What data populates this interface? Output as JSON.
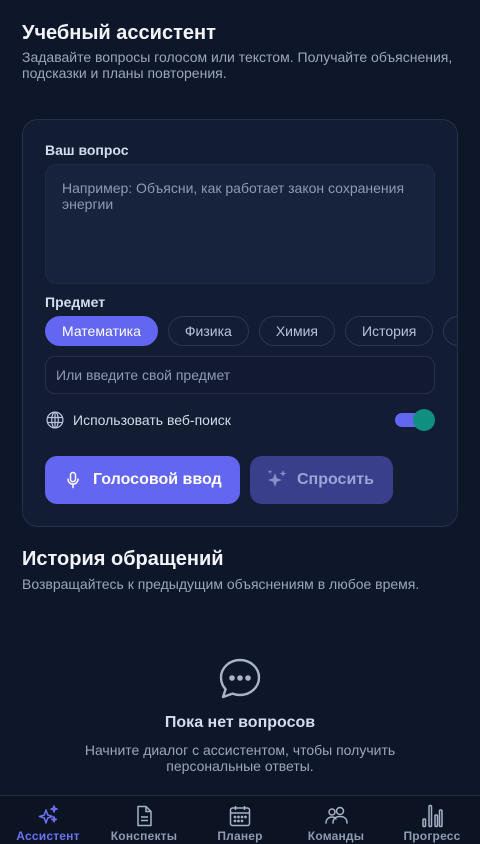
{
  "header": {
    "title": "Учебный ассистент",
    "subtitle": "Задавайте вопросы голосом или текстом. Получайте объяснения, подсказки и планы повторения."
  },
  "question": {
    "label": "Ваш вопрос",
    "placeholder": "Например: Объясни, как работает закон сохранения энергии"
  },
  "subject": {
    "label": "Предмет",
    "chips": [
      {
        "label": "Математика",
        "active": true
      },
      {
        "label": "Физика",
        "active": false
      },
      {
        "label": "Химия",
        "active": false
      },
      {
        "label": "История",
        "active": false
      }
    ],
    "custom_placeholder": "Или введите свой предмет"
  },
  "web_search": {
    "label": "Использовать веб-поиск",
    "enabled": true,
    "icon": "globe-icon"
  },
  "actions": {
    "voice_label": "Голосовой ввод",
    "voice_icon": "microphone-icon",
    "ask_label": "Спросить",
    "ask_icon": "sparkles-icon"
  },
  "history": {
    "title": "История обращений",
    "subtitle": "Возвращайтесь к предыдущим объяснениям в любое время.",
    "empty_icon": "chat-bubble-icon",
    "empty_title": "Пока нет вопросов",
    "empty_text": "Начните диалог с ассистентом, чтобы получить персональные ответы."
  },
  "nav": {
    "items": [
      {
        "label": "Ассистент",
        "icon": "sparkles-icon",
        "active": true
      },
      {
        "label": "Конспекты",
        "icon": "document-icon",
        "active": false
      },
      {
        "label": "Планер",
        "icon": "calendar-icon",
        "active": false
      },
      {
        "label": "Команды",
        "icon": "users-icon",
        "active": false
      },
      {
        "label": "Прогресс",
        "icon": "bar-chart-icon",
        "active": false
      }
    ]
  },
  "colors": {
    "background": "#0e1729",
    "accent": "#6366f1",
    "toggle_knob": "#0f8f80"
  }
}
